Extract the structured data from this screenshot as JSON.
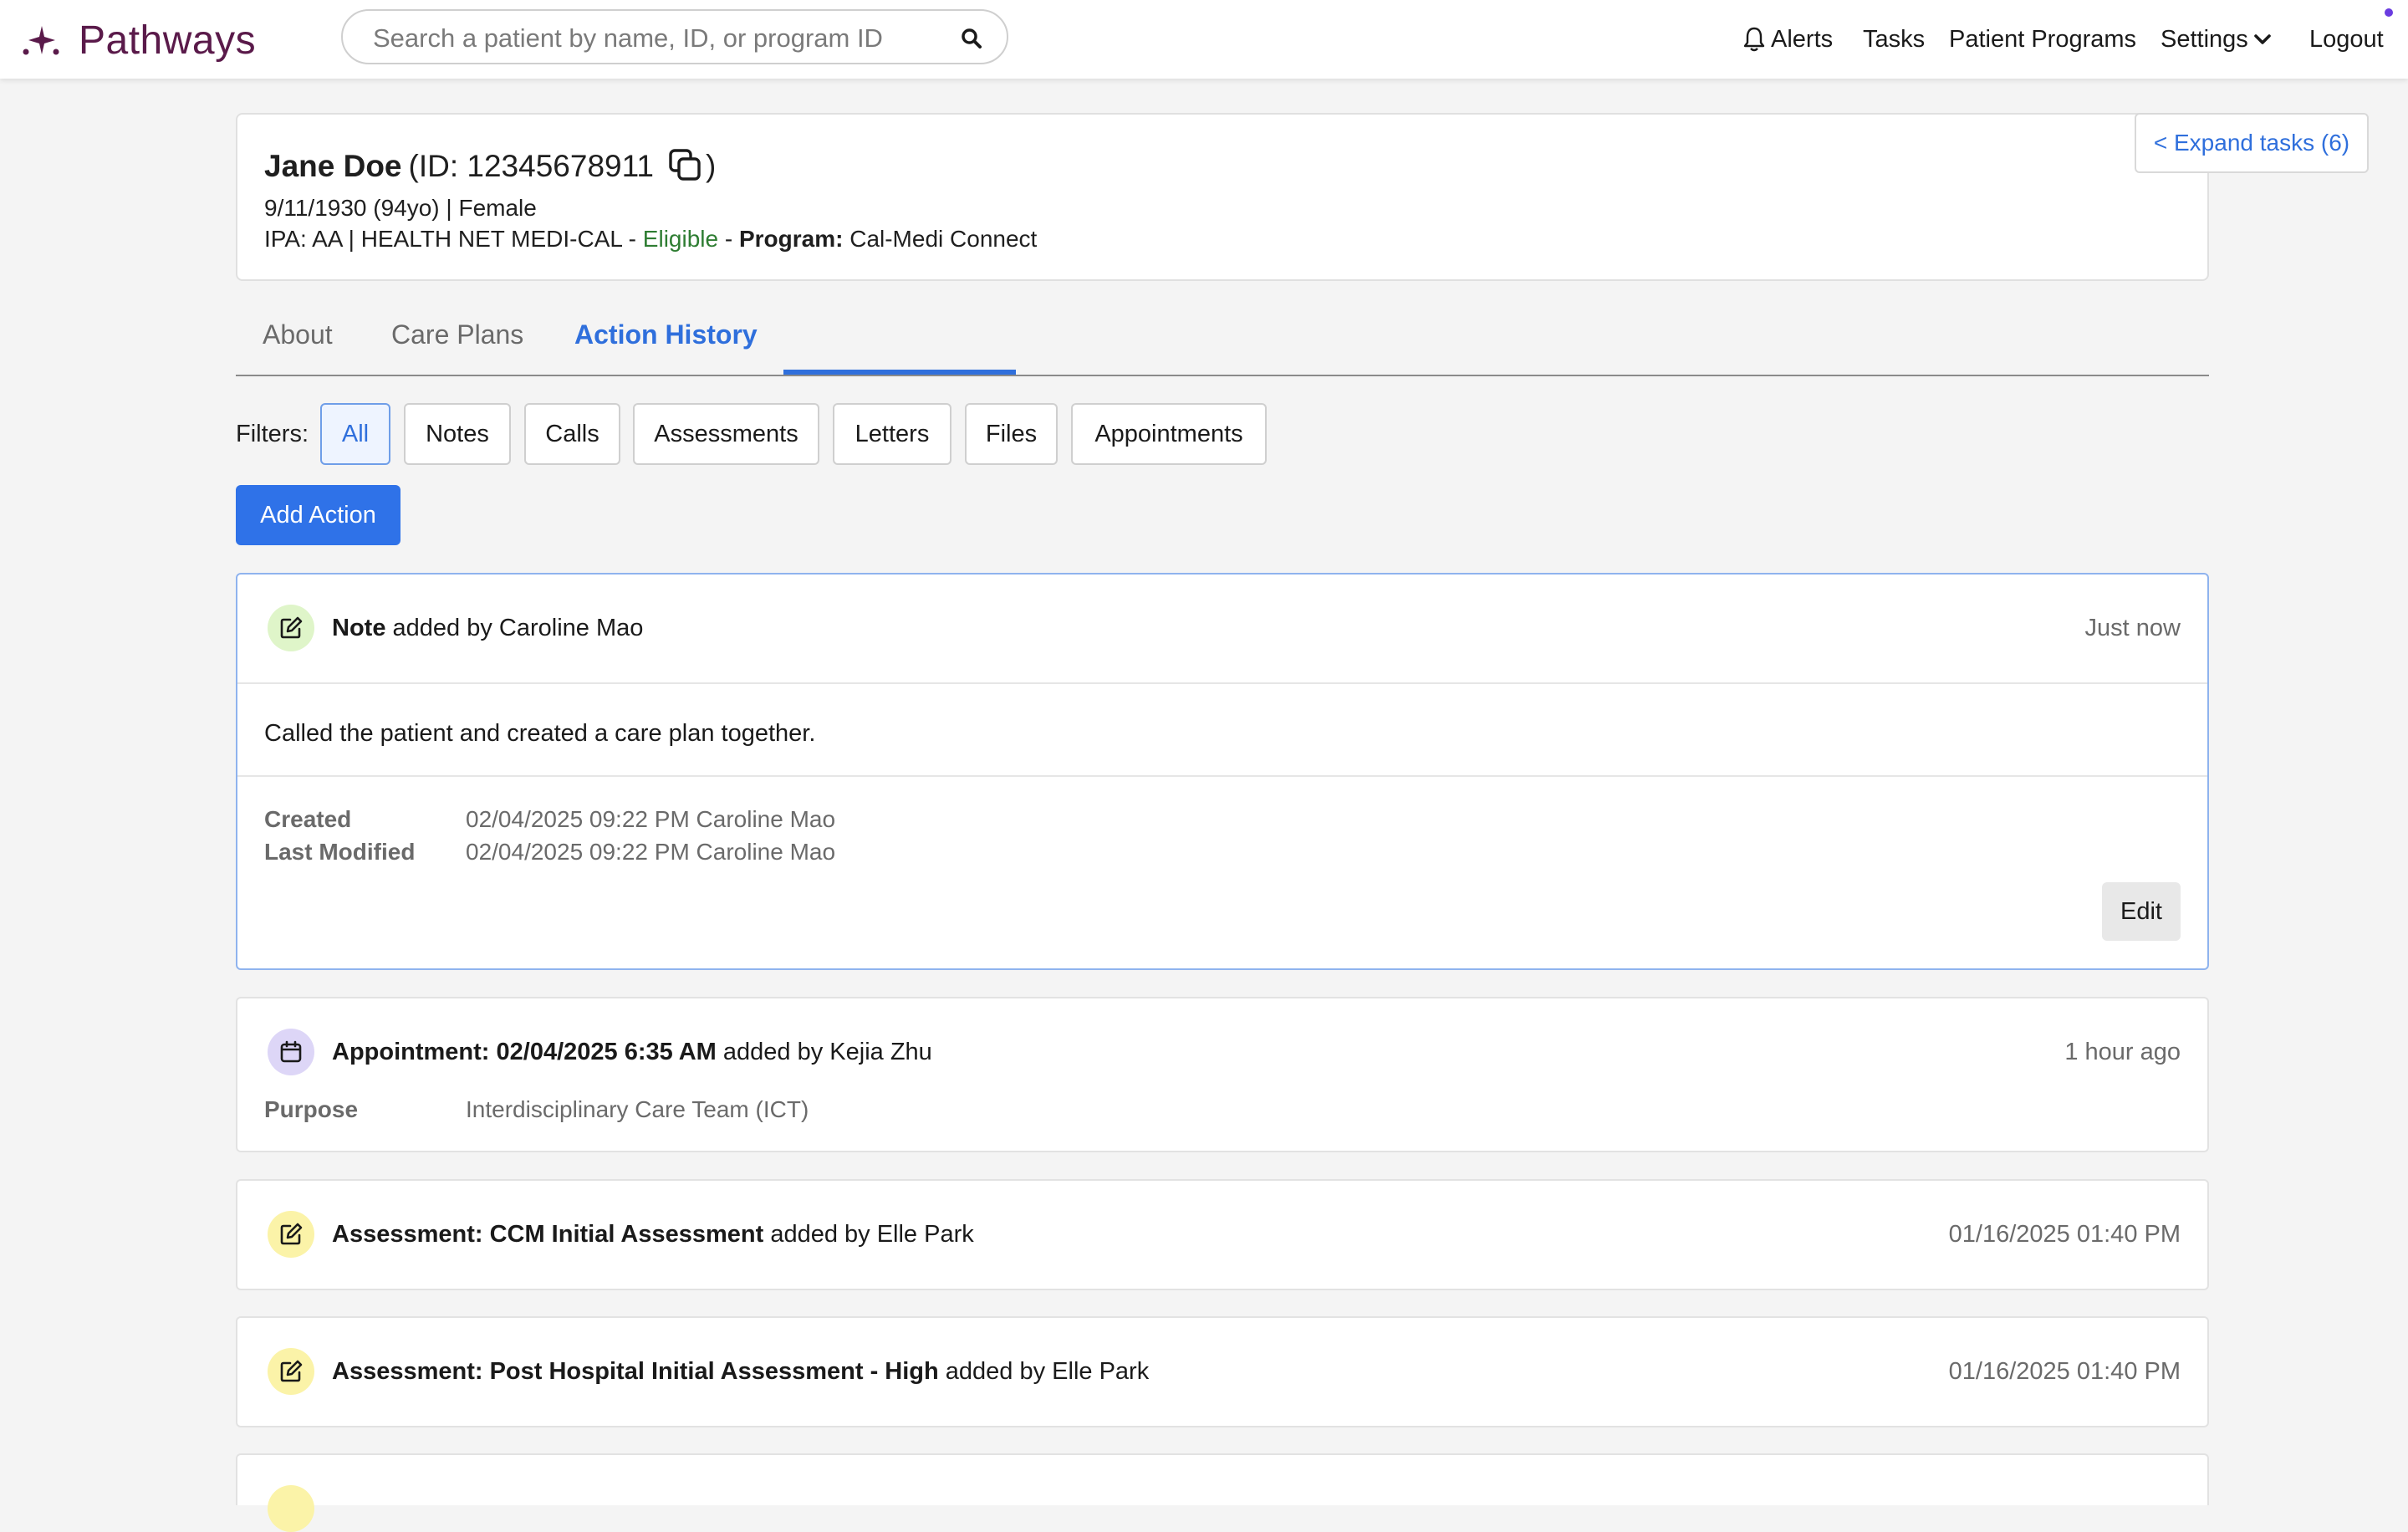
{
  "app": {
    "name": "Pathways",
    "brand_color": "#5a1a4a",
    "accent_color": "#2f6fdc"
  },
  "search": {
    "placeholder": "Search a patient by name, ID, or program ID",
    "icon": "search-icon"
  },
  "nav": {
    "alerts": "Alerts",
    "tasks": "Tasks",
    "patient_programs": "Patient Programs",
    "settings": "Settings",
    "logout": "Logout"
  },
  "patient": {
    "name": "Jane Doe",
    "id_label": "(ID: 12345678911",
    "id_close": ")",
    "dob_line": "9/11/1930 (94yo) | Female",
    "ipa": "IPA: AA | HEALTH NET MEDI-CAL - ",
    "eligibility": "Eligible",
    "sep": " - ",
    "program_label": "Program:",
    "program": " Cal-Medi Connect"
  },
  "expand_tasks": "< Expand tasks (6)",
  "tabs": [
    {
      "label": "About"
    },
    {
      "label": "Care Plans"
    },
    {
      "label": "Action History"
    }
  ],
  "active_tab": "Action History",
  "filters": {
    "label": "Filters:",
    "options": [
      "All",
      "Notes",
      "Calls",
      "Assessments",
      "Letters",
      "Files",
      "Appointments"
    ],
    "selected": "All"
  },
  "add_action": "Add Action",
  "actions": [
    {
      "type_bold": "Note",
      "rest": " added by Caroline Mao",
      "time": "Just now",
      "body": "Called the patient and created a care plan together.",
      "created_label": "Created",
      "created_value": "02/04/2025 09:22 PM Caroline Mao",
      "modified_label": "Last Modified",
      "modified_value": "02/04/2025 09:22 PM Caroline Mao",
      "edit_label": "Edit"
    },
    {
      "type_bold": "Appointment: 02/04/2025 6:35 AM",
      "rest": " added by Kejia Zhu",
      "time": "1 hour ago",
      "purpose_label": "Purpose",
      "purpose_value": "Interdisciplinary Care Team (ICT)"
    },
    {
      "type_bold": "Assessment: CCM Initial Assessment",
      "rest": " added by Elle Park",
      "time": "01/16/2025 01:40 PM"
    },
    {
      "type_bold": "Assessment: Post Hospital Initial Assessment - High",
      "rest": " added by Elle Park",
      "time": "01/16/2025 01:40 PM"
    }
  ]
}
